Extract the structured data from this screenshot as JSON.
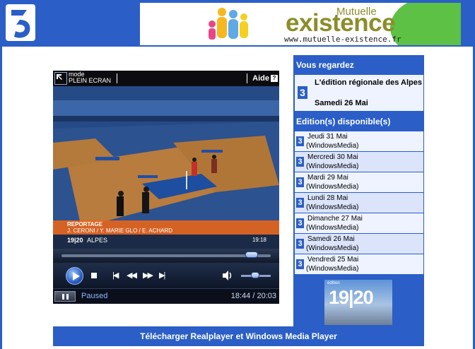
{
  "header": {
    "logo": "france-3-logo",
    "ad": {
      "brand_top": "Mutuelle",
      "brand": "existence",
      "url": "www.mutuelle-existence.fr"
    }
  },
  "player": {
    "fullscreen_label_line1": "mode",
    "fullscreen_label_line2": "PLEIN ECRAN",
    "help_label": "Aide",
    "help_icon": "?",
    "video": {
      "caption_title": "REPORTAGE",
      "caption_names": "J. CERONI / Y. MARIE GLO / E. ACHARD",
      "program": "19|20",
      "region": "ALPES",
      "clock": "19:18"
    },
    "seek_progress": 0.94,
    "volume_level": 0.5,
    "status": "Paused",
    "time": "18:44 / 20:03"
  },
  "sidebar": {
    "now_watching_heading": "Vous regardez",
    "current": {
      "title": "L'édition régionale des Alpes",
      "date": "Samedi 26 Mai"
    },
    "editions_heading": "Edition(s) disponible(s)",
    "editions": [
      {
        "date": "Jeudi 31 Mai",
        "format": "(WindowsMedia)"
      },
      {
        "date": "Mercredi 30 Mai",
        "format": "(WindowsMedia)"
      },
      {
        "date": "Mardi 29 Mai",
        "format": "(WindowsMedia)"
      },
      {
        "date": "Lundi 28 Mai",
        "format": "(WindowsMedia)"
      },
      {
        "date": "Dimanche 27 Mai",
        "format": "(WindowsMedia)"
      },
      {
        "date": "Samedi 26 Mai",
        "format": "(WindowsMedia)"
      },
      {
        "date": "Vendredi 25 Mai",
        "format": "(WindowsMedia)"
      }
    ],
    "thumbnail": {
      "small": "édition",
      "big": "19|20"
    }
  },
  "footer": {
    "download_label": "Télécharger Realplayer et Windows Media Player"
  },
  "colors": {
    "brand_blue": "#2b5fc7",
    "ad_olive": "#8b8d2a",
    "ad_green": "#5cc144",
    "caption_orange": "#e8641a"
  }
}
